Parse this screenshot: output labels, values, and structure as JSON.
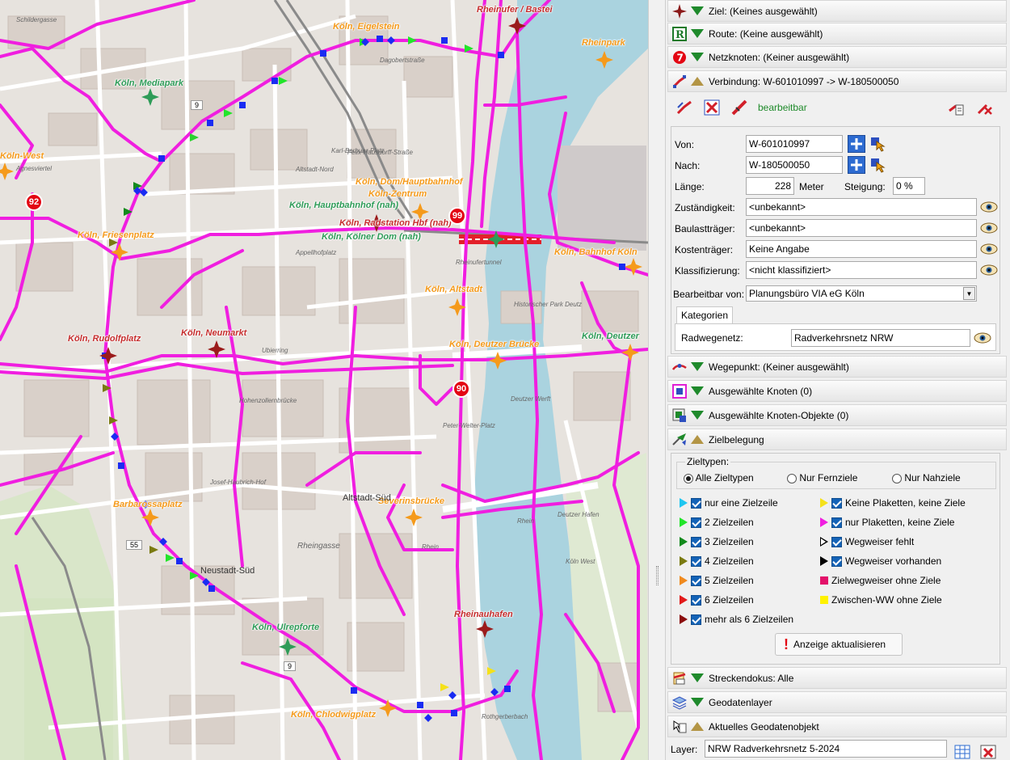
{
  "map": {
    "places": [
      {
        "name": "Rheinufer / Bastei",
        "color": "r"
      },
      {
        "name": "Köln, Eigelstein",
        "color": "o"
      },
      {
        "name": "Rheinpark",
        "color": "o"
      },
      {
        "name": "Köln, Mediapark",
        "color": "g"
      },
      {
        "name": "Köln-West",
        "color": "o"
      },
      {
        "name": "Köln, Dom/Hauptbahnhof",
        "color": "o"
      },
      {
        "name": "Köln-Zentrum",
        "color": "o"
      },
      {
        "name": "Köln, Hauptbahnhof (nah)",
        "color": "g"
      },
      {
        "name": "Köln, Radstation Hbf (nah)",
        "color": "r"
      },
      {
        "name": "Köln, Kölner Dom (nah)",
        "color": "g"
      },
      {
        "name": "Köln, Friesenplatz",
        "color": "o"
      },
      {
        "name": "Köln, Bahnhof Köln",
        "color": "o"
      },
      {
        "name": "Köln, Altstadt",
        "color": "o"
      },
      {
        "name": "Köln, Rudolfplatz",
        "color": "r"
      },
      {
        "name": "Köln, Neumarkt",
        "color": "r"
      },
      {
        "name": "Köln, Deutzer Brücke",
        "color": "o"
      },
      {
        "name": "Köln, Deutzer",
        "color": "g"
      },
      {
        "name": "Barbarossaplatz",
        "color": "o"
      },
      {
        "name": "Severinsbrücke",
        "color": "o"
      },
      {
        "name": "Köln, Ulrepforte",
        "color": "g"
      },
      {
        "name": "Rheinauhafen",
        "color": "r"
      },
      {
        "name": "Köln, Chlodwigplatz",
        "color": "o"
      }
    ],
    "streets": [
      "Dagobertstraße",
      "Felix-Hausdorff-Straße",
      "Altstadt-Nord",
      "Appellhofplatz",
      "Rheinufertunnel",
      "Historischer Park Deutz",
      "Deutzer Werft",
      "Peter-Welter-Platz",
      "Altstadt-Süd",
      "Neustadt-Süd",
      "Deutzer Hafen",
      "Rhein",
      "Rhein",
      "Rheingasse",
      "Karl-Berbuer-Platz",
      "Hohenzollernbrücke",
      "Josef-Haubrich-Hof",
      "Rothgerberbach",
      "Ubierring",
      "Schildergasse",
      "Agnesviertel",
      "Köln West",
      "Hansaring"
    ],
    "badges": [
      "92",
      "99",
      "90"
    ],
    "road_numbers": [
      "9",
      "55",
      "9"
    ]
  },
  "panel": {
    "headers": {
      "ziel": "Ziel: (Keines ausgewählt)",
      "route": "Route: (Keine ausgewählt)",
      "netzknoten": "Netzknoten: (Keiner ausgewählt)",
      "verbindung": "Verbindung: W-601010997 -> W-180500050",
      "wegepunkt": "Wegepunkt: (Keiner ausgewählt)",
      "knoten": "Ausgewählte Knoten (0)",
      "knoten_objekte": "Ausgewählte Knoten-Objekte (0)",
      "zielbelegung": "Zielbelegung",
      "streckendokus": "Streckendokus: Alle",
      "geodatenlayer": "Geodatenlayer",
      "geodatenobjekt": "Aktuelles Geodatenobjekt"
    },
    "verbindung": {
      "status": "bearbeitbar",
      "von_label": "Von:",
      "von": "W-601010997",
      "nach_label": "Nach:",
      "nach": "W-180500050",
      "laenge_label": "Länge:",
      "laenge": "228",
      "laenge_unit": "Meter",
      "steigung_label": "Steigung:",
      "steigung": "0 %",
      "zustaendigkeit_label": "Zuständigkeit:",
      "zustaendigkeit": "<unbekannt>",
      "baulasttraeger_label": "Baulastträger:",
      "baulasttraeger": "<unbekannt>",
      "kostentraeger_label": "Kostenträger:",
      "kostentraeger": "Keine Angabe",
      "klassifizierung_label": "Klassifizierung:",
      "klassifizierung": "<nicht klassifiziert>",
      "bearbeitbar_label": "Bearbeitbar von:",
      "bearbeitbar": "Planungsbüro VIA eG Köln",
      "tab": "Kategorien",
      "radwegenetz_label": "Radwegenetz:",
      "radwegenetz": "Radverkehrsnetz NRW"
    },
    "zielbelegung": {
      "group_label": "Zieltypen:",
      "radios": [
        "Alle Zieltypen",
        "Nur Fernziele",
        "Nur Nahziele"
      ],
      "left": [
        {
          "label": "nur eine Zielzeile",
          "color": "#1fc6f0"
        },
        {
          "label": "2 Zielzeilen",
          "color": "#22e52a"
        },
        {
          "label": "3 Zielzeilen",
          "color": "#128a1c"
        },
        {
          "label": "4 Zielzeilen",
          "color": "#7a7a10"
        },
        {
          "label": "5 Zielzeilen",
          "color": "#f08a1e"
        },
        {
          "label": "6 Zielzeilen",
          "color": "#e21a1a"
        },
        {
          "label": "mehr als 6 Zielzeilen",
          "color": "#8b0d0d"
        }
      ],
      "right": [
        {
          "label": "Keine Plaketten, keine Ziele",
          "color": "#f5e11a"
        },
        {
          "label": "nur Plaketten, keine Ziele",
          "color": "#f01ee0"
        },
        {
          "label": "Wegweiser fehlt",
          "color": "#ffffff"
        },
        {
          "label": "Wegweiser vorhanden",
          "color": "#000000"
        },
        {
          "label": "Zielwegweiser ohne Ziele",
          "color": "#e3116a"
        },
        {
          "label": "Zwischen-WW ohne Ziele",
          "color": "#fff200"
        }
      ],
      "refresh": "Anzeige aktualisieren"
    },
    "geodaten": {
      "layer_label": "Layer:",
      "layer": "NRW Radverkehrsnetz 5-2024"
    }
  }
}
